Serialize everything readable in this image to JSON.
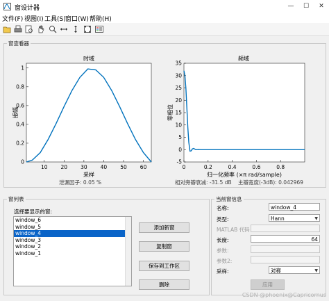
{
  "window": {
    "title": "窗设计器",
    "minimize": "—",
    "maximize": "☐",
    "close": "✕"
  },
  "menu": [
    "文件(F)",
    "视图(I)",
    "工具(S)",
    "窗口(W)",
    "帮助(H)"
  ],
  "toolbar_icons": [
    "open-icon",
    "print-icon",
    "print-preview-icon",
    "pan-hand-icon",
    "zoom-in-icon",
    "zoom-x-icon",
    "zoom-y-icon",
    "full-view-icon",
    "legend-icon"
  ],
  "viewer": {
    "title": "窗查看器",
    "time": {
      "title": "时域",
      "xlabel": "采样",
      "ylabel": "振幅",
      "xticks": [
        "10",
        "20",
        "30",
        "40",
        "50",
        "60"
      ],
      "yticks": [
        "0",
        "0.2",
        "0.4",
        "0.6",
        "0.8",
        "1"
      ],
      "info": "泄漏因子: 0.05 %"
    },
    "freq": {
      "title": "频域",
      "xlabel": "归一化频率 (×π rad/sample)",
      "ylabel": "零相位",
      "xticks": [
        "0",
        "0.2",
        "0.4",
        "0.6",
        "0.8"
      ],
      "yticks": [
        "-5",
        "0",
        "5",
        "10",
        "15",
        "20",
        "25",
        "30",
        "35"
      ],
      "info_left": "相对旁瓣衰减: -31.5 dB",
      "info_right": "主瓣宽度(-3dB): 0.042969"
    }
  },
  "chart_data": [
    {
      "type": "line",
      "title": "时域",
      "xlabel": "采样",
      "ylabel": "振幅",
      "xlim": [
        1,
        64
      ],
      "ylim": [
        0,
        1.05
      ],
      "series": [
        {
          "name": "",
          "x": [
            1,
            4,
            8,
            12,
            16,
            20,
            24,
            28,
            32,
            36,
            40,
            44,
            48,
            52,
            56,
            60,
            64
          ],
          "values": [
            0,
            0.02,
            0.1,
            0.24,
            0.41,
            0.59,
            0.76,
            0.9,
            0.99,
            0.98,
            0.9,
            0.76,
            0.59,
            0.41,
            0.24,
            0.1,
            0
          ]
        }
      ]
    },
    {
      "type": "line",
      "title": "频域",
      "xlabel": "归一化频率 (×π rad/sample)",
      "ylabel": "零相位",
      "xlim": [
        0,
        1
      ],
      "ylim": [
        -5,
        35
      ],
      "series": [
        {
          "name": "",
          "x": [
            0,
            0.008,
            0.016,
            0.024,
            0.032,
            0.04,
            0.05,
            0.06,
            0.07,
            0.08,
            0.09,
            0.1,
            0.12,
            0.14,
            0.2,
            0.3,
            0.5,
            0.7,
            1.0
          ],
          "values": [
            32,
            30,
            25,
            17,
            9,
            3,
            -0.6,
            -0.5,
            0.3,
            0.5,
            0.2,
            0,
            0.05,
            0,
            0,
            0,
            0,
            0,
            0
          ]
        }
      ]
    }
  ],
  "window_list": {
    "panel_title": "窗列表",
    "prompt": "选择要显示的窗:",
    "items": [
      "window_6",
      "window_5",
      "window_4",
      "window_3",
      "window_2",
      "window_1"
    ],
    "selected": "window_4",
    "buttons": {
      "add": "添加新窗",
      "copy": "复制窗",
      "save": "保存到工作区",
      "delete": "删除"
    }
  },
  "current_info": {
    "panel_title": "当前窗信息",
    "name_label": "名称:",
    "name_value": "window_4",
    "type_label": "类型:",
    "type_value": "Hann",
    "matlab_label": "MATLAB 代码",
    "length_label": "长度:",
    "length_value": "64",
    "param_label": "参数:",
    "param2_label": "参数2:",
    "sampling_label": "采样:",
    "sampling_value": "对称",
    "apply": "应用"
  },
  "watermark": "CSDN @phoenix@Capricornus",
  "colors": {
    "line": "#0072bd",
    "selection": "#0a64c8"
  }
}
